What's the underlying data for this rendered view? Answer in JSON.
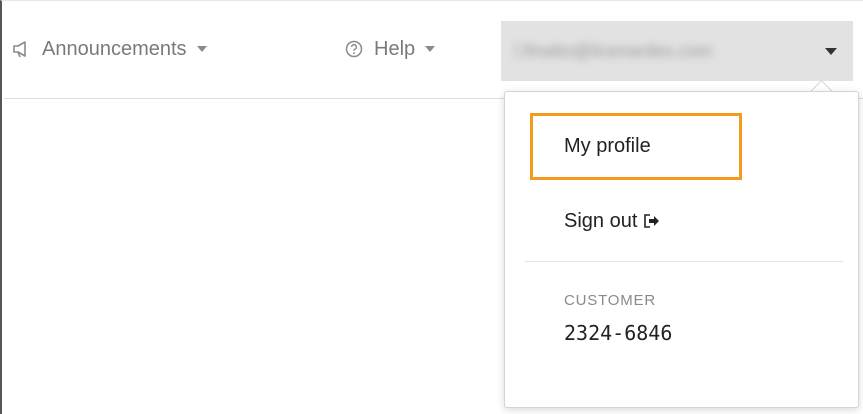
{
  "topbar": {
    "announcements_label": "Announcements",
    "help_label": "Help",
    "user_email": "l.finatto@licenardes.com"
  },
  "user_menu": {
    "my_profile_label": "My profile",
    "sign_out_label": "Sign out",
    "customer_label": "CUSTOMER",
    "customer_number": "2324-6846"
  },
  "icons": {
    "announcements": "megaphone-icon",
    "help": "question-circle-icon",
    "sign_out": "sign-out-icon"
  },
  "colors": {
    "highlight": "#f39a1f",
    "user_button_bg": "#e2e2e2"
  }
}
